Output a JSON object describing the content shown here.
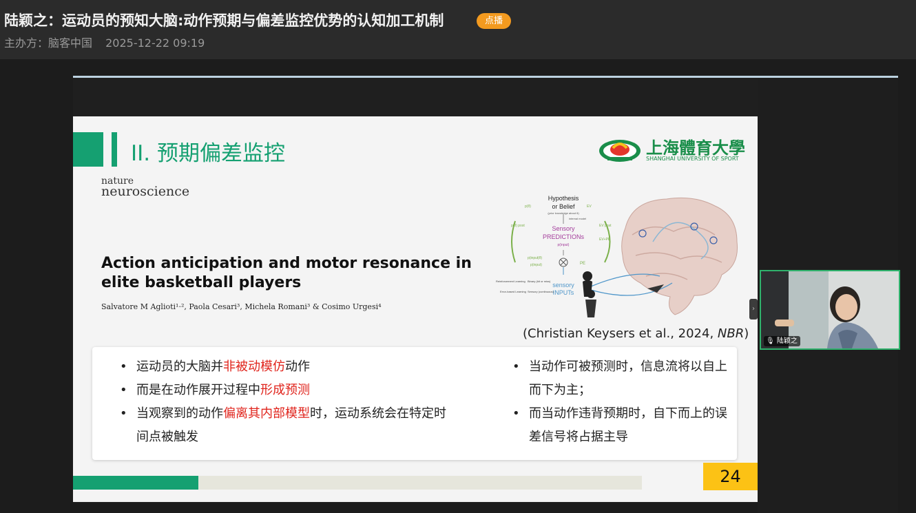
{
  "header": {
    "title": "陆颖之：运动员的预知大脑:动作预期与偏差监控优势的认知加工机制",
    "badge": "点播",
    "organizer": "主办方：脑客中国",
    "datetime": "2025-12-22 09:19"
  },
  "slide": {
    "section_title": "II. 预期偏差监控",
    "logo_cn": "上海體育大學",
    "logo_en": "SHANGHAI UNIVERSITY OF SPORT",
    "journal_line1": "nature",
    "journal_line2": "neuroscience",
    "paper_title": "Action anticipation and motor resonance in elite basketball players",
    "authors": "Salvatore M Aglioti¹·², Paola Cesari³, Michela Romani³ & Cosimo Urgesi⁴",
    "figure": {
      "hypothesis": "Hypothesis",
      "or_belief": "or Belief",
      "prior": "(prior knowledge about θ)",
      "internal_model": "internal model",
      "sensory": "Sensory",
      "predictions": "PREDICTIONs",
      "p_input": "p(input)",
      "pe": "PE",
      "sensory_inputs_1": "sensory",
      "sensory_inputs_2": "INPUTs",
      "reinforcement": "Reinforcement Learning",
      "binary": "Binary (hit or miss)",
      "error_based": "Error-based Learning",
      "sensory_cont": "Sensory (continuous)",
      "ev": "EV",
      "ev_post": "EV post",
      "ev_ipe": "EV+PE",
      "p_theta": "p(θ)",
      "p_theta_post": "p(θ) post",
      "p_input_theta": "p(input|θ)"
    },
    "citation_prefix": "(Christian Keysers et al., 2024, ",
    "citation_journal": "NBR",
    "citation_suffix": ")",
    "bullets_left": [
      {
        "pre": "运动员的大脑并",
        "red": "非被动模仿",
        "post": "动作"
      },
      {
        "pre": "而是在动作展开过程中",
        "red": "形成预测",
        "post": ""
      },
      {
        "pre": "当观察到的动作",
        "red": "偏离其内部模型",
        "post": "时，运动系统会在特定时间点被触发"
      }
    ],
    "bullets_right": [
      "当动作可被预测时，信息流将以自上而下为主；",
      "而当动作违背预期时，自下而上的误差信号将占据主导"
    ],
    "page_number": "24",
    "progress": 0.22
  },
  "participant": {
    "name": "陆颖之"
  },
  "colors": {
    "accent_green": "#15a071",
    "badge_orange": "#f39a1f",
    "highlight_red": "#e0241c",
    "page_yellow": "#fcc215"
  }
}
